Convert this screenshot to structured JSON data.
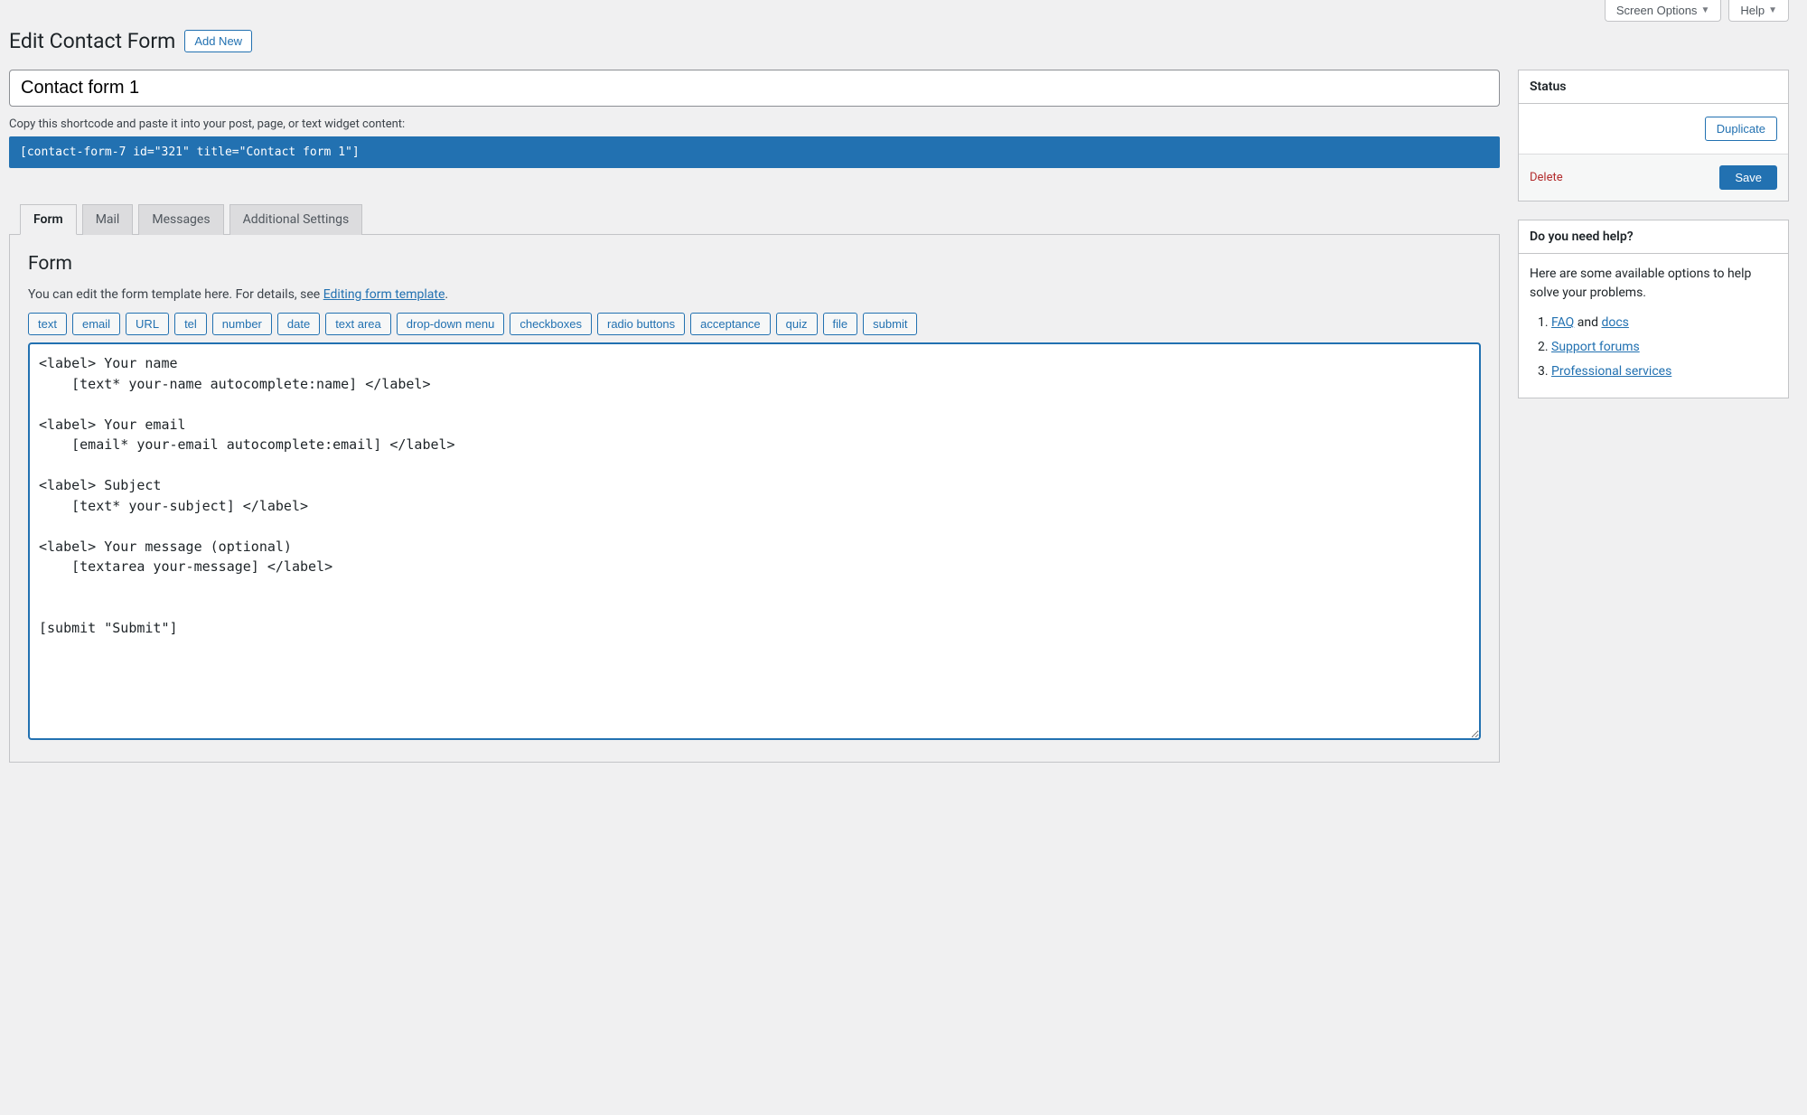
{
  "topbar": {
    "screen_options": "Screen Options",
    "help": "Help"
  },
  "header": {
    "title": "Edit Contact Form",
    "add_new": "Add New"
  },
  "form_title": "Contact form 1",
  "shortcode": {
    "label": "Copy this shortcode and paste it into your post, page, or text widget content:",
    "value": "[contact-form-7 id=\"321\" title=\"Contact form 1\"]"
  },
  "tabs": {
    "form": "Form",
    "mail": "Mail",
    "messages": "Messages",
    "additional": "Additional Settings"
  },
  "panel": {
    "heading": "Form",
    "desc_prefix": "You can edit the form template here. For details, see ",
    "desc_link": "Editing form template",
    "desc_suffix": "."
  },
  "tag_buttons": [
    "text",
    "email",
    "URL",
    "tel",
    "number",
    "date",
    "text area",
    "drop-down menu",
    "checkboxes",
    "radio buttons",
    "acceptance",
    "quiz",
    "file",
    "submit"
  ],
  "template_content": "<label> Your name\n    [text* your-name autocomplete:name] </label>\n\n<label> Your email\n    [email* your-email autocomplete:email] </label>\n\n<label> Subject\n    [text* your-subject] </label>\n\n<label> Your message (optional)\n    [textarea your-message] </label>\n\n\n[submit \"Submit\"]",
  "sidebar": {
    "status": {
      "title": "Status",
      "duplicate": "Duplicate",
      "delete": "Delete",
      "save": "Save"
    },
    "help": {
      "title": "Do you need help?",
      "text": "Here are some available options to help solve your problems.",
      "items": [
        {
          "prefix": "",
          "link1": "FAQ",
          "mid": " and ",
          "link2": "docs",
          "suffix": ""
        },
        {
          "prefix": "",
          "link1": "Support forums",
          "mid": "",
          "link2": "",
          "suffix": ""
        },
        {
          "prefix": "",
          "link1": "Professional services",
          "mid": "",
          "link2": "",
          "suffix": ""
        }
      ]
    }
  }
}
